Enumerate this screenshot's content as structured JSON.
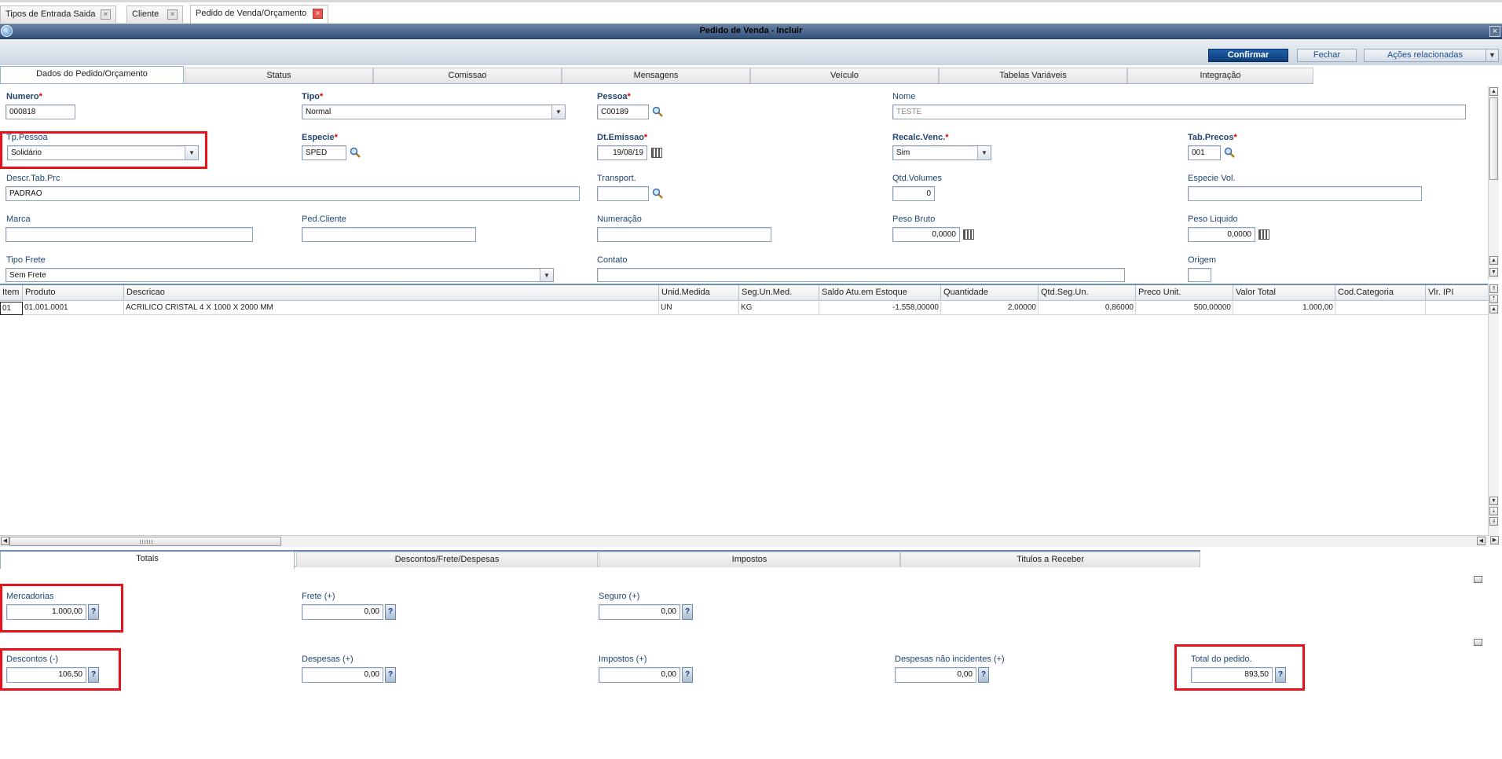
{
  "window_tabs": [
    {
      "label": "Tipos de Entrada Saida"
    },
    {
      "label": "Cliente"
    },
    {
      "label": "Pedido de Venda/Orçamento"
    }
  ],
  "window": {
    "title": "Pedido de Venda - Incluir",
    "close": "×"
  },
  "toolbar": {
    "confirm": "Confirmar",
    "close": "Fechar",
    "actions": "Ações relacionadas"
  },
  "tabs": [
    "Dados do Pedido/Orçamento",
    "Status",
    "Comissao",
    "Mensagens",
    "Veículo",
    "Tabelas Variáveis",
    "Integração"
  ],
  "form": {
    "numero": {
      "label": "Numero",
      "value": "000818"
    },
    "tipo": {
      "label": "Tipo",
      "value": "Normal"
    },
    "pessoa": {
      "label": "Pessoa",
      "value": "C00189"
    },
    "nome": {
      "label": "Nome",
      "value": "TESTE"
    },
    "tp_pessoa": {
      "label": "Tp.Pessoa",
      "value": "Solidário"
    },
    "especie": {
      "label": "Especie",
      "value": "SPED"
    },
    "dt_emissao": {
      "label": "Dt.Emissao",
      "value": "19/08/19"
    },
    "recalc_venc": {
      "label": "Recalc.Venc.",
      "value": "Sim"
    },
    "tab_precos": {
      "label": "Tab.Precos",
      "value": "001"
    },
    "descr_tab_prc": {
      "label": "Descr.Tab.Prc",
      "value": "PADRAO"
    },
    "transport": {
      "label": "Transport.",
      "value": ""
    },
    "qtd_volumes": {
      "label": "Qtd.Volumes",
      "value": "0"
    },
    "especie_vol": {
      "label": "Especie Vol.",
      "value": ""
    },
    "marca": {
      "label": "Marca",
      "value": ""
    },
    "ped_cliente": {
      "label": "Ped.Cliente",
      "value": ""
    },
    "numeracao": {
      "label": "Numeração",
      "value": ""
    },
    "peso_bruto": {
      "label": "Peso Bruto",
      "value": "0,0000"
    },
    "peso_liquido": {
      "label": "Peso Liquido",
      "value": "0,0000"
    },
    "tipo_frete": {
      "label": "Tipo Frete",
      "value": "Sem Frete"
    },
    "contato": {
      "label": "Contato",
      "value": ""
    },
    "origem": {
      "label": "Origem",
      "value": ""
    }
  },
  "grid": {
    "columns": [
      "Item",
      "Produto",
      "Descricao",
      "Unid.Medida",
      "Seg.Un.Med.",
      "Saldo Atu.em Estoque",
      "Quantidade",
      "Qtd.Seg.Un.",
      "Preco Unit.",
      "Valor Total",
      "Cod.Categoria",
      "Vlr. IPI"
    ],
    "rows": [
      [
        "01",
        "01.001.0001",
        "ACRILICO CRISTAL 4 X 1000 X 2000 MM",
        "UN",
        "KG",
        "-1.558,00000",
        "2,00000",
        "0,86000",
        "500,00000",
        "1.000,00",
        "",
        ""
      ]
    ]
  },
  "bottom_tabs": [
    "Totais",
    "Descontos/Frete/Despesas",
    "Impostos",
    "Titulos a Receber"
  ],
  "totals": {
    "mercadorias": {
      "label": "Mercadorias",
      "value": "1.000,00"
    },
    "frete": {
      "label": "Frete (+)",
      "value": "0,00"
    },
    "seguro": {
      "label": "Seguro (+)",
      "value": "0,00"
    },
    "descontos": {
      "label": "Descontos (-)",
      "value": "106,50"
    },
    "despesas": {
      "label": "Despesas (+)",
      "value": "0,00"
    },
    "impostos": {
      "label": "Impostos (+)",
      "value": "0,00"
    },
    "despesas_nao_inc": {
      "label": "Despesas não incidentes (+)",
      "value": "0,00"
    },
    "total_pedido": {
      "label": "Total do pedido.",
      "value": "893,50"
    },
    "help": "?"
  },
  "colors": {
    "accent": "#0d3d78",
    "highlight": "#e8101a",
    "label": "#20466f"
  },
  "icons": [
    "search-icon",
    "calendar-icon",
    "calculator-icon",
    "dropdown-arrow-icon",
    "help-icon"
  ]
}
